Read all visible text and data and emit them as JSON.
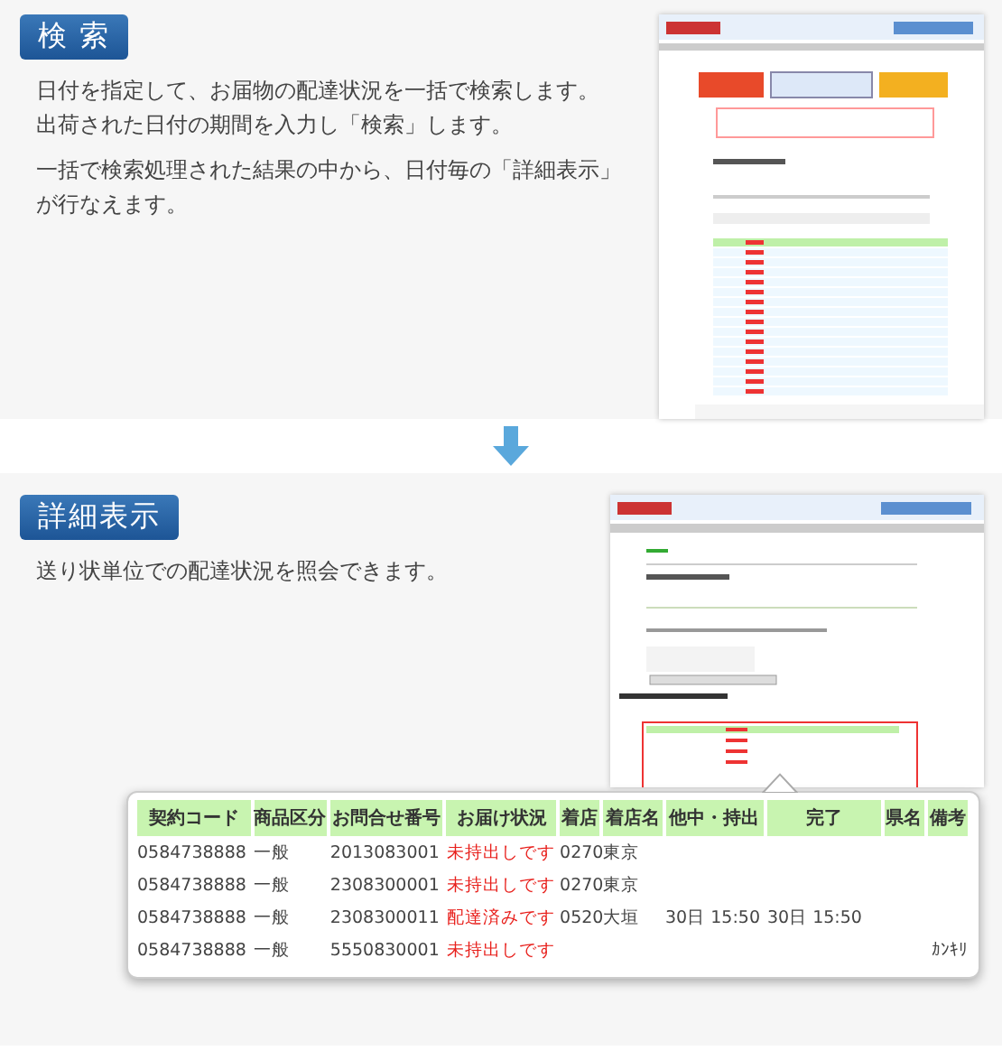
{
  "sections": [
    {
      "title": "検 索",
      "paragraphs": [
        [
          "日付を指定して、お届物の配達状況を一括で検索します。",
          "出荷された日付の期間を入力し「検索」します。"
        ],
        [
          "一括で検索処理された結果の中から、日付毎の「詳細表示」",
          "が行なえます。"
        ]
      ]
    },
    {
      "title": "詳細表示",
      "paragraphs": [
        [
          "送り状単位での配達状況を照会できます。"
        ]
      ]
    }
  ],
  "detail_table": {
    "columns": [
      "契約コード",
      "商品区分",
      "お問合せ番号",
      "お届け状況",
      "着店",
      "着店名",
      "他中・持出",
      "完了",
      "県名",
      "備考"
    ],
    "rows": [
      [
        "0584738888",
        "一般",
        "2013083001",
        "未持出しです",
        "0270",
        "東京",
        "",
        "",
        "",
        ""
      ],
      [
        "0584738888",
        "一般",
        "2308300001",
        "未持出しです",
        "0270",
        "東京",
        "",
        "",
        "",
        ""
      ],
      [
        "0584738888",
        "一般",
        "2308300011",
        "配達済みです",
        "0520",
        "大垣",
        "30日 15:50",
        "30日 15:50",
        "",
        ""
      ],
      [
        "0584738888",
        "一般",
        "5550830001",
        "未持出しです",
        "",
        "",
        "",
        "",
        "",
        "ｶﾝｷﾘ"
      ]
    ]
  }
}
